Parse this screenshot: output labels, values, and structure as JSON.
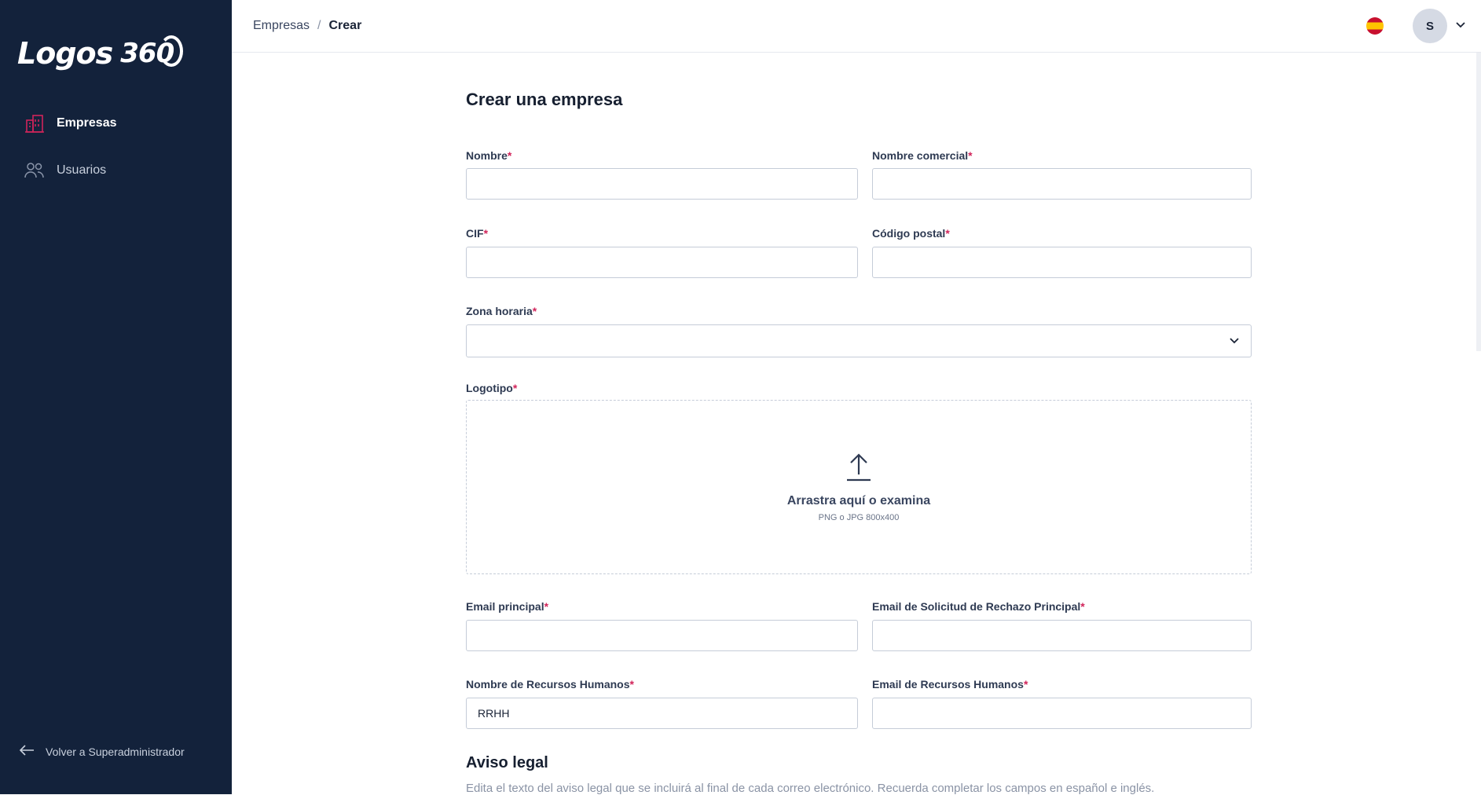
{
  "sidebar": {
    "logo": {
      "text": "Logos",
      "number": "360"
    },
    "items": [
      {
        "label": "Empresas",
        "icon": "building-icon",
        "active": true
      },
      {
        "label": "Usuarios",
        "icon": "users-icon",
        "active": false
      }
    ],
    "back_label": "Volver a Superadministrador"
  },
  "header": {
    "breadcrumb": {
      "parent": "Empresas",
      "separator": "/",
      "current": "Crear"
    },
    "language_flag": "spain-flag-icon",
    "user_initial": "S"
  },
  "form": {
    "title": "Crear una empresa",
    "fields": {
      "nombre": {
        "label": "Nombre",
        "value": ""
      },
      "nombre_comercial": {
        "label": "Nombre comercial",
        "value": ""
      },
      "cif": {
        "label": "CIF",
        "value": ""
      },
      "codigo_postal": {
        "label": "Código postal",
        "value": ""
      },
      "zona_horaria": {
        "label": "Zona horaria",
        "value": ""
      },
      "logotipo": {
        "label": "Logotipo",
        "drop_text": "Arrastra aquí o examina",
        "hint": "PNG o JPG 800x400"
      },
      "email_principal": {
        "label": "Email principal",
        "value": ""
      },
      "email_rechazo": {
        "label": "Email de Solicitud de Rechazo Principal",
        "value": ""
      },
      "nombre_rrhh": {
        "label": "Nombre de Recursos Humanos",
        "value": "RRHH"
      },
      "email_rrhh": {
        "label": "Email de Recursos Humanos",
        "value": ""
      }
    },
    "required_mark": "*",
    "aviso": {
      "title": "Aviso legal",
      "description": "Edita el texto del aviso legal que se incluirá al final de cada correo electrónico. Recuerda completar los campos en español e inglés."
    }
  },
  "colors": {
    "sidebar_bg": "#13223b",
    "accent": "#d1245a",
    "border": "#c5ccd8"
  }
}
